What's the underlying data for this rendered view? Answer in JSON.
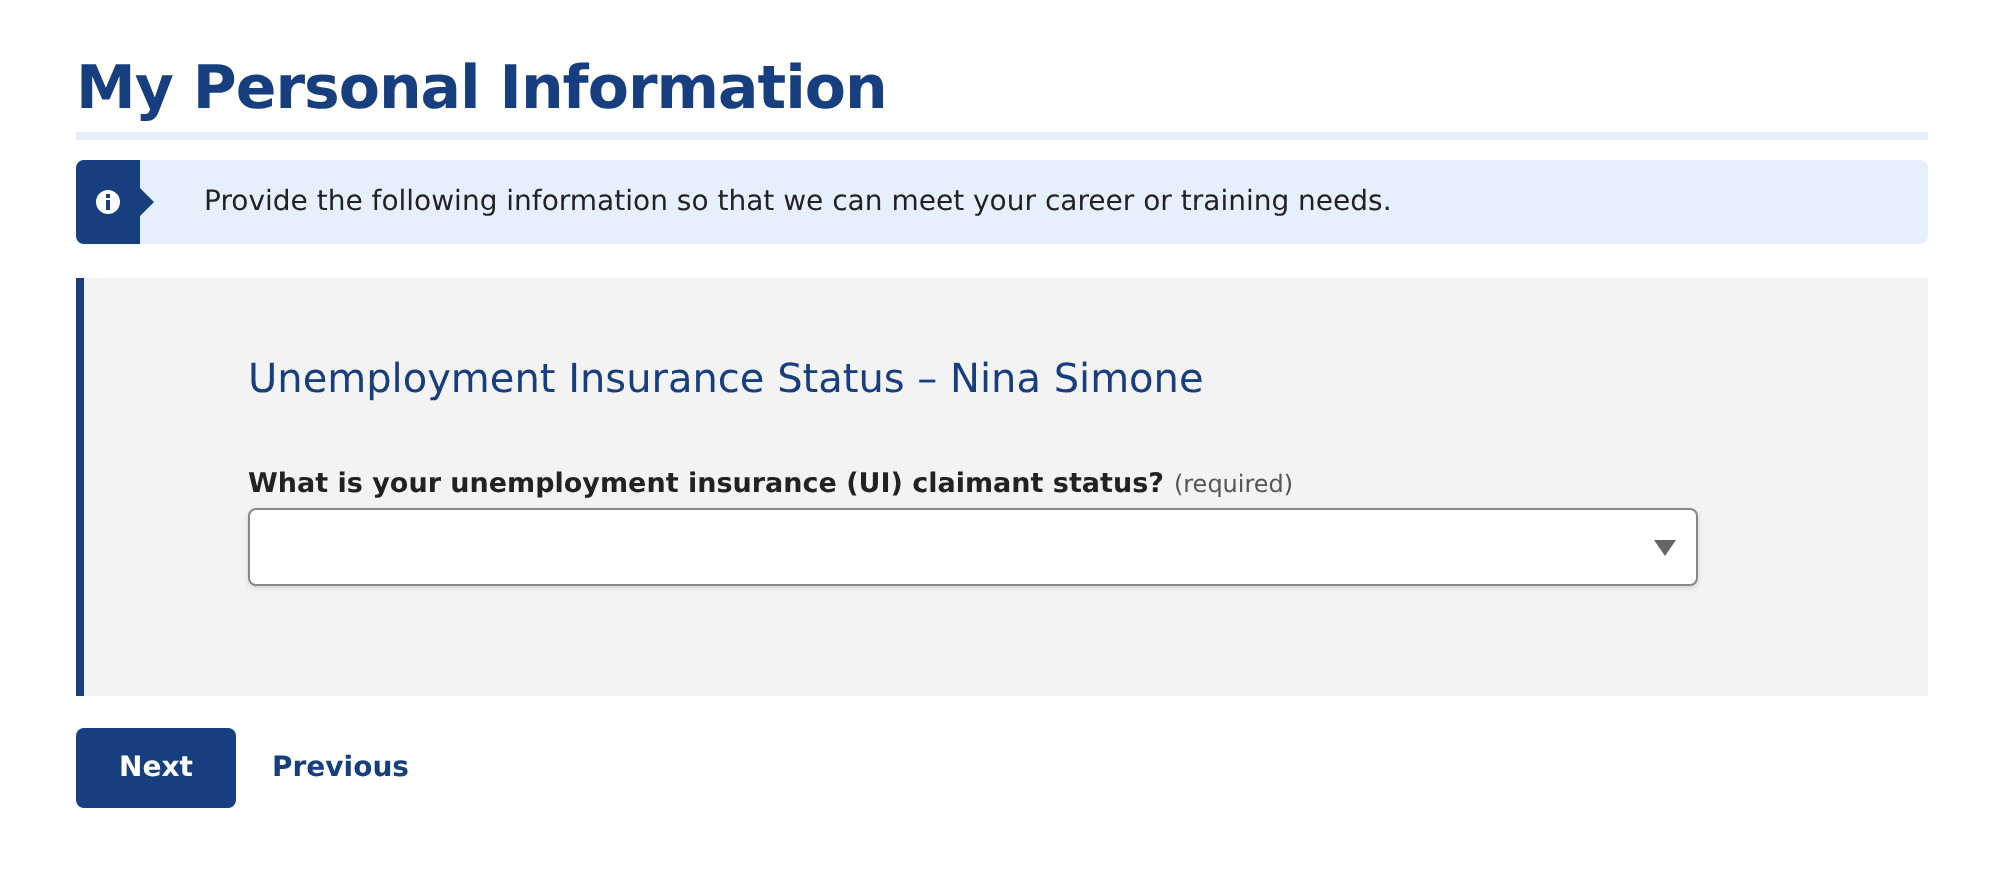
{
  "page_title": "My Personal Information",
  "info_alert": {
    "text": "Provide the following information so that we can meet your career or training needs."
  },
  "section": {
    "title": "Unemployment Insurance Status – Nina Simone",
    "question": {
      "label": "What is your unemployment insurance (UI) claimant status?",
      "hint": "(required)"
    }
  },
  "buttons": [
    {
      "kind": "primary",
      "label": "Next"
    },
    {
      "kind": "link",
      "label": "Previous"
    }
  ]
}
